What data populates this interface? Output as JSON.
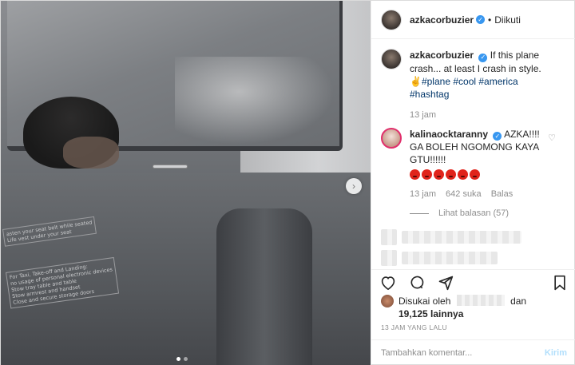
{
  "post": {
    "username": "azkacorbuzier",
    "separator": "•",
    "follow_status": "Diikuti",
    "caption": {
      "username": "azkacorbuzier",
      "text": "If this plane crash... at least I crash in style.",
      "emoji": "✌",
      "hashtags": [
        "#plane",
        "#cool",
        "#america",
        "#hashtag"
      ],
      "time": "13 jam"
    },
    "comments": [
      {
        "username": "kalinaocktaranny",
        "text": "AZKA!!!! GA BOLEH NGOMONG KAYA GTU!!!!!!",
        "emoji_count": 6,
        "time": "13 jam",
        "likes": "642 suka",
        "reply_label": "Balas",
        "view_replies": "Lihat balasan (57)"
      }
    ],
    "liked_by_prefix": "Disukai oleh",
    "liked_by_and": "dan",
    "likes_count": "19,125 lainnya",
    "time_ago": "13 JAM YANG LALU",
    "comment_placeholder": "Tambahkan komentar...",
    "send_label": "Kirim"
  },
  "media": {
    "placard_1": "asten your seat belt while seated\nLife vest under your seat",
    "placard_2": "For Taxi, Take-off and Landing:\nno usage of personal electronic devices\nStow tray table and table\nStow armrest and handset\nClose and secure storage doors",
    "carousel_total": 2,
    "carousel_active": 1,
    "next_icon": "chevron-right-icon"
  },
  "colors": {
    "verified": "#3897f0",
    "hashtag": "#003569",
    "muted": "#8e8e8e",
    "send_disabled": "#b2dffc",
    "angry_emoji": "#e0241b"
  }
}
